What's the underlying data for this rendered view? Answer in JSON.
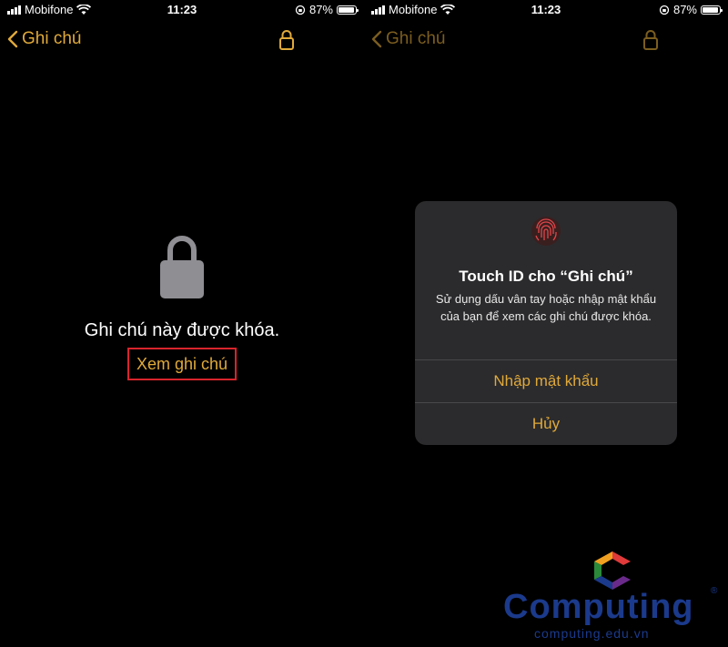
{
  "status_bar": {
    "carrier": "Mobifone",
    "time": "11:23",
    "battery": "87%",
    "battery_level": 0.87
  },
  "left_screen": {
    "back_label": "Ghi chú",
    "locked_message": "Ghi chú này được khóa.",
    "view_note_button": "Xem ghi chú"
  },
  "right_screen": {
    "back_label": "Ghi chú",
    "dialog": {
      "title": "Touch ID cho “Ghi chú”",
      "message": "Sử dụng dấu vân tay hoặc nhập mật khẩu của bạn để xem các ghi chú được khóa.",
      "enter_password_button": "Nhập mật khẩu",
      "cancel_button": "Hủy"
    }
  },
  "watermark": {
    "brand": "Computing",
    "url": "computing.edu.vn",
    "registered": "®"
  },
  "colors": {
    "accent": "#e0a93a",
    "highlight_box": "#d8242c",
    "dialog_bg": "#2b2b2d",
    "brand_blue": "#1b3a8c"
  }
}
